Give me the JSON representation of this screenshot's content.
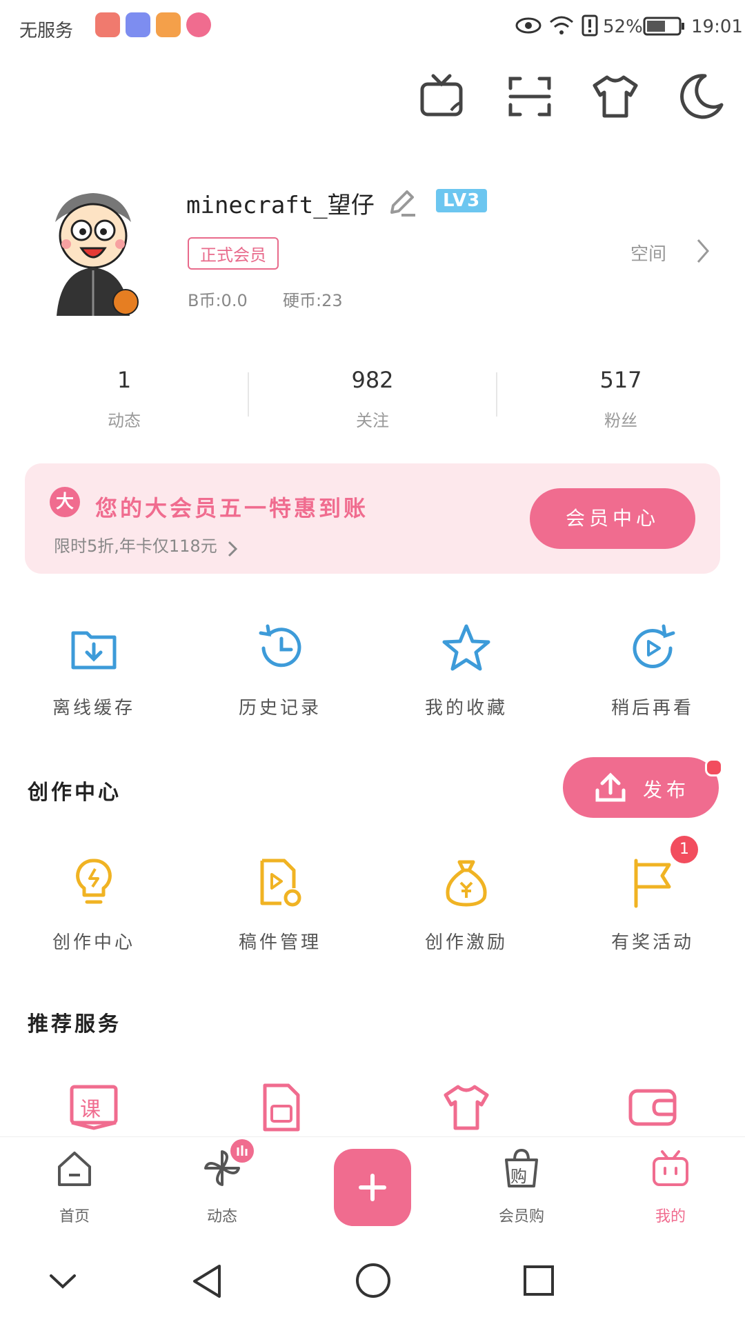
{
  "status_bar": {
    "carrier": "无服务",
    "battery": "52%",
    "time": "19:01",
    "apps": [
      {
        "name": "huawei-app-icon",
        "color": "#f07a6e"
      },
      {
        "name": "music-app-icon",
        "color": "#7d8df0"
      },
      {
        "name": "video-app-icon",
        "color": "#f4a04a"
      },
      {
        "name": "bilibili-app-icon",
        "color": "#f06c8f"
      }
    ]
  },
  "top_icons": [
    "tv-cast-icon",
    "scan-icon",
    "tshirt-icon",
    "moon-icon"
  ],
  "profile": {
    "username": "minecraft_望仔",
    "level": "LV3",
    "member": "正式会员",
    "b_coins": "B币:0.0",
    "hard_coins": "硬币:23",
    "space": "空间"
  },
  "stats": [
    {
      "value": "1",
      "label": "动态"
    },
    {
      "value": "982",
      "label": "关注"
    },
    {
      "value": "517",
      "label": "粉丝"
    }
  ],
  "banner": {
    "badge": "大",
    "title": "您的大会员五一特惠到账",
    "subtitle": "限时5折,年卡仅118元",
    "button": "会员中心"
  },
  "quick_actions": [
    {
      "label": "离线缓存",
      "icon": "download-folder-icon"
    },
    {
      "label": "历史记录",
      "icon": "history-clock-icon"
    },
    {
      "label": "我的收藏",
      "icon": "star-icon"
    },
    {
      "label": "稍后再看",
      "icon": "watch-later-icon"
    }
  ],
  "creation": {
    "title": "创作中心",
    "publish": "发布",
    "items": [
      {
        "label": "创作中心",
        "icon": "lightbulb-icon"
      },
      {
        "label": "稿件管理",
        "icon": "manuscript-icon"
      },
      {
        "label": "创作激励",
        "icon": "money-bag-icon"
      },
      {
        "label": "有奖活动",
        "icon": "flag-icon"
      }
    ],
    "activity_badge": "1"
  },
  "recommended": {
    "title": "推荐服务",
    "items": [
      {
        "icon": "course-book-icon",
        "text": "课"
      },
      {
        "icon": "sim-card-icon"
      },
      {
        "icon": "tshirt-shop-icon"
      },
      {
        "icon": "wallet-icon"
      }
    ]
  },
  "bottom_nav": [
    {
      "label": "首页",
      "icon": "home-icon"
    },
    {
      "label": "动态",
      "icon": "pinwheel-icon"
    },
    {
      "label": "会员购",
      "icon": "shopping-bag-icon",
      "text": "购"
    },
    {
      "label": "我的",
      "icon": "tv-mascot-icon"
    }
  ],
  "colors": {
    "accent": "#f06c8f",
    "blue": "#3d9bd9",
    "gold": "#f0b323"
  }
}
